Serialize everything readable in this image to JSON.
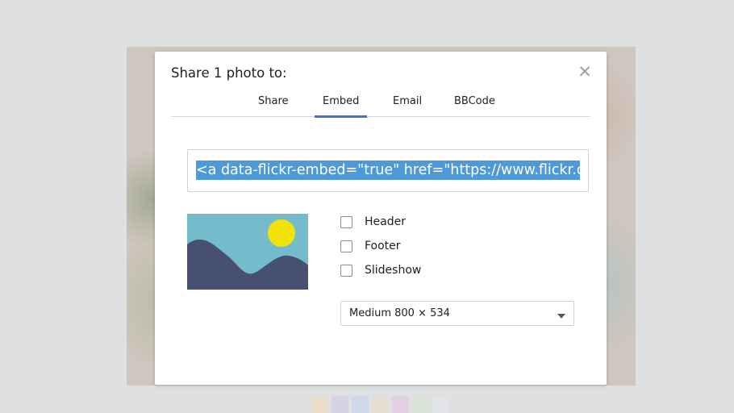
{
  "modal": {
    "title": "Share 1 photo to:",
    "close_icon": "close-icon"
  },
  "tabs": [
    {
      "label": "Share",
      "active": false
    },
    {
      "label": "Embed",
      "active": true
    },
    {
      "label": "Email",
      "active": false
    },
    {
      "label": "BBCode",
      "active": false
    }
  ],
  "embed": {
    "code_visible": "<a data-flickr-embed=\"true\"  href=\"https://www.flickr.co"
  },
  "options": [
    {
      "label": "Header",
      "checked": false
    },
    {
      "label": "Footer",
      "checked": false
    },
    {
      "label": "Slideshow",
      "checked": false
    }
  ],
  "size_select": {
    "selected": "Medium 800 × 534"
  },
  "preview_icon": "image-placeholder-icon",
  "colors": {
    "accent": "#4b6fd0",
    "selection": "#4e9ad8",
    "preview_sky": "#74bccb",
    "preview_mountain": "#474f73",
    "preview_sun": "#f3e10a"
  }
}
